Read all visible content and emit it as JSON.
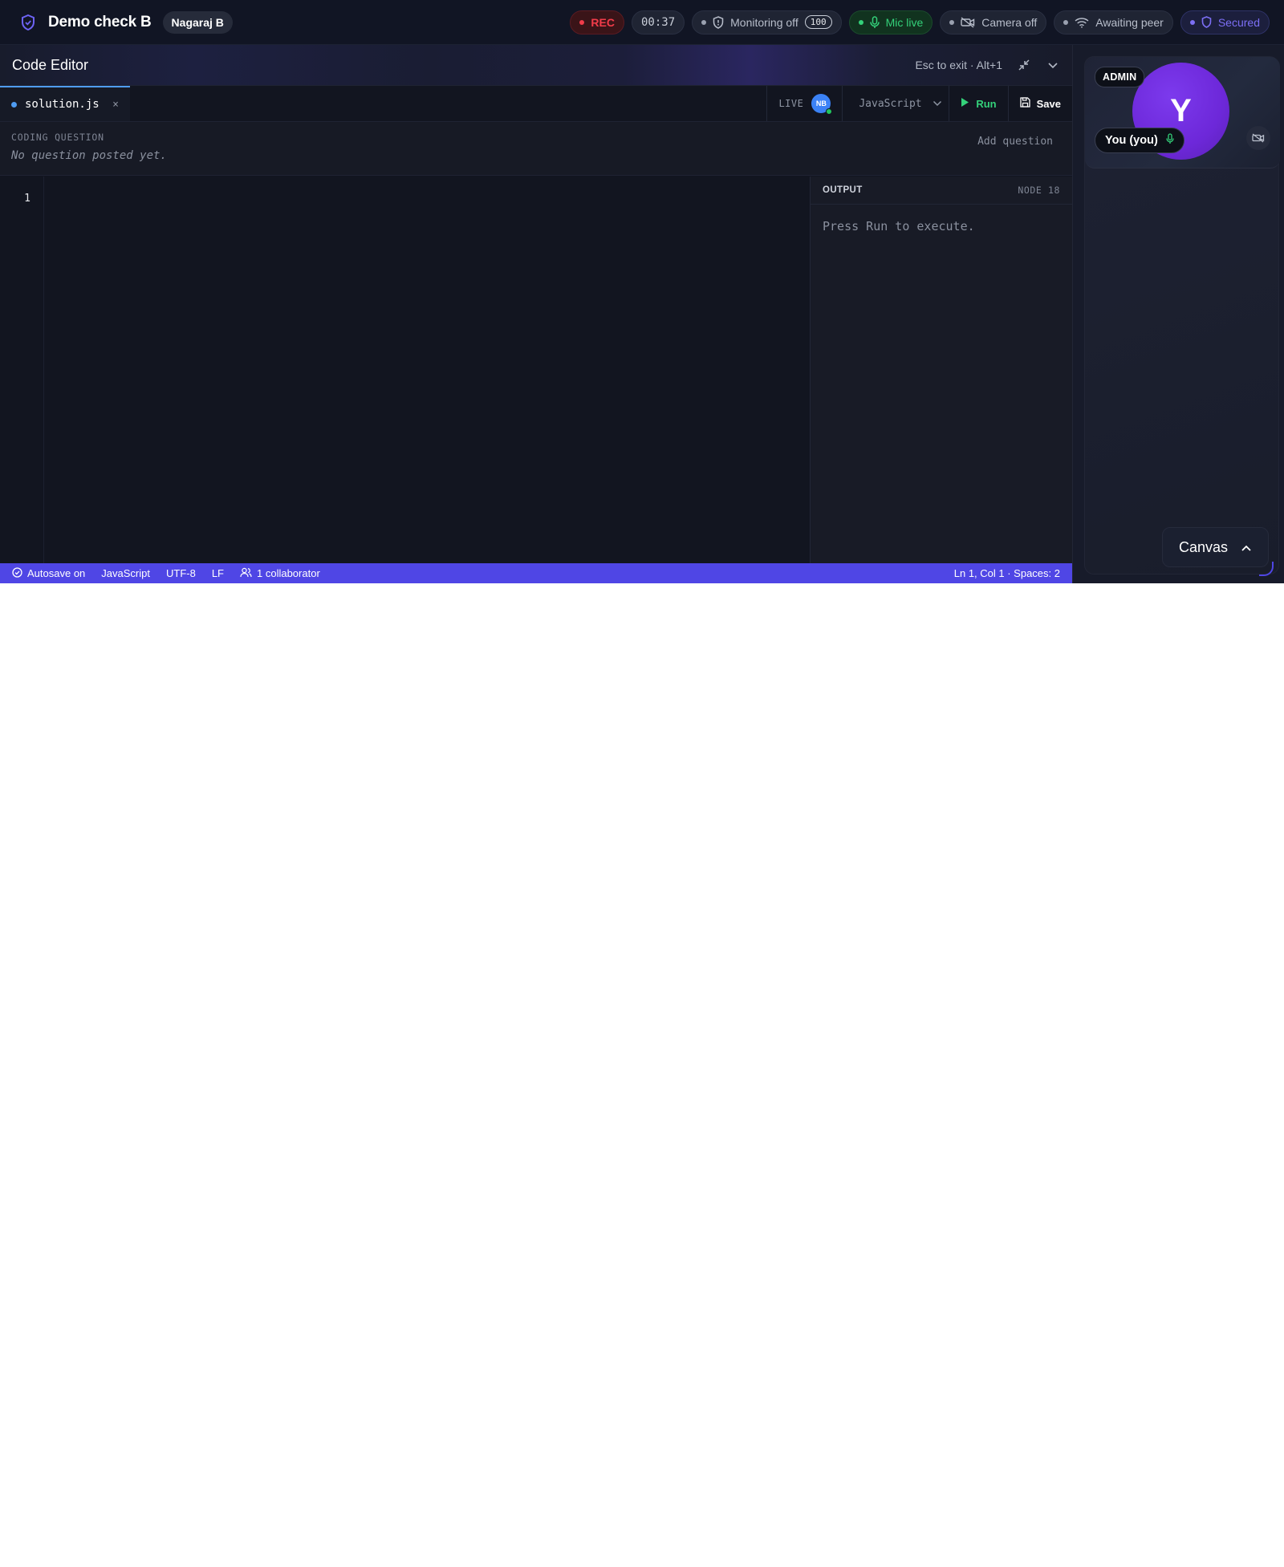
{
  "header": {
    "app_title": "Demo check B",
    "user_name": "Nagaraj B",
    "rec_label": "REC",
    "timer": "00:37",
    "monitoring_label": "Monitoring off",
    "monitoring_count": "100",
    "mic_label": "Mic live",
    "camera_label": "Camera off",
    "peer_label": "Awaiting peer",
    "secured_label": "Secured"
  },
  "editor": {
    "title": "Code Editor",
    "exit_hint": "Esc to exit · Alt+1",
    "tab": {
      "filename": "solution.js",
      "close": "×"
    },
    "live_label": "LIVE",
    "collaborator_initials": "NB",
    "language": "JavaScript",
    "run_label": "Run",
    "save_label": "Save",
    "question": {
      "label": "CODING QUESTION",
      "text": "No question posted yet.",
      "add_label": "Add question"
    },
    "line_numbers": [
      "1"
    ],
    "output": {
      "title": "OUTPUT",
      "runtime": "NODE 18",
      "message": "Press Run to execute."
    }
  },
  "statusbar": {
    "autosave": "Autosave on",
    "language": "JavaScript",
    "encoding": "UTF-8",
    "line_ending": "LF",
    "collaborators": "1 collaborator",
    "cursor": "Ln 1, Col 1 · Spaces: 2"
  },
  "participant": {
    "role": "ADMIN",
    "initial": "Y",
    "name": "You (you)"
  },
  "canvas": {
    "label": "Canvas"
  },
  "colors": {
    "accent": "#4f46e5",
    "avatar": "#6d28d9",
    "rec": "#f23c4a",
    "live": "#34d17a",
    "tab_accent": "#4f9cf2"
  },
  "icons": {
    "logo": "shield-icon",
    "monitoring": "shield-icon",
    "mic": "mic-icon",
    "camera": "camera-off-icon",
    "peer": "wifi-icon",
    "secured": "shield-icon",
    "minimize": "minimize-icon",
    "collapse": "chevron-down-icon",
    "language": "chevron-down-icon",
    "run": "play-icon",
    "save": "save-icon",
    "autosave": "check-circle-icon",
    "collaborators": "users-icon",
    "canvas": "chevron-up-icon"
  }
}
